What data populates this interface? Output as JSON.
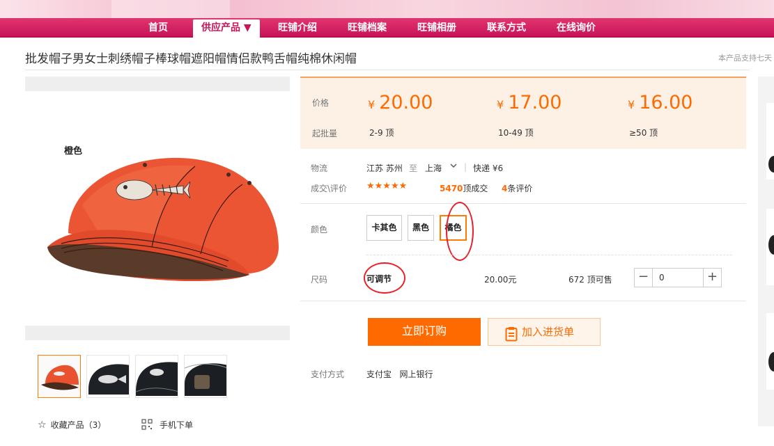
{
  "nav": {
    "items": [
      {
        "label": "首页"
      },
      {
        "label": "供应产品 ▼",
        "active": true
      },
      {
        "label": "旺铺介绍"
      },
      {
        "label": "旺铺档案"
      },
      {
        "label": "旺铺相册"
      },
      {
        "label": "联系方式"
      },
      {
        "label": "在线询价"
      }
    ]
  },
  "product": {
    "title": "批发帽子男女士刺绣帽子棒球帽遮阳帽情侣款鸭舌帽纯棉休闲帽",
    "side_note": "本产品支持七天",
    "image_color_label": "橙色"
  },
  "price_tiers": {
    "price_label": "价格",
    "moq_label": "起批量",
    "currency": "¥",
    "tiers": [
      {
        "price": "20.00",
        "range": "2-9 顶"
      },
      {
        "price": "17.00",
        "range": "10-49 顶"
      },
      {
        "price": "16.00",
        "range": "≥50 顶"
      }
    ]
  },
  "logistics": {
    "label": "物流",
    "origin": "江苏 苏州",
    "to": "至",
    "destination": "上海",
    "shipping": "快递 ¥6"
  },
  "deals": {
    "label": "成交\\评价",
    "rating": 4.5,
    "stars": "★★★★★",
    "sold_count": "5470",
    "sold_suffix": "顶成交",
    "review_count": "4",
    "review_suffix": "条评价"
  },
  "color": {
    "label": "颜色",
    "options": [
      "卡其色",
      "黑色",
      "橘色"
    ],
    "selected": "橘色"
  },
  "size": {
    "label": "尺码",
    "value": "可调节",
    "unit_price": "20.00元",
    "stock": "672 顶可售",
    "quantity": "0",
    "minus": "−",
    "plus": "+"
  },
  "actions": {
    "buy": "立即订购",
    "add_cart": "加入进货单"
  },
  "payment": {
    "label": "支付方式",
    "methods": "支付宝   网上银行"
  },
  "footer": {
    "favorite": "收藏产品（3）",
    "mobile_order": "手机下单"
  },
  "colors": {
    "accent": "#ff6a00",
    "nav": "#c8145a",
    "annotation": "#e8202a"
  }
}
